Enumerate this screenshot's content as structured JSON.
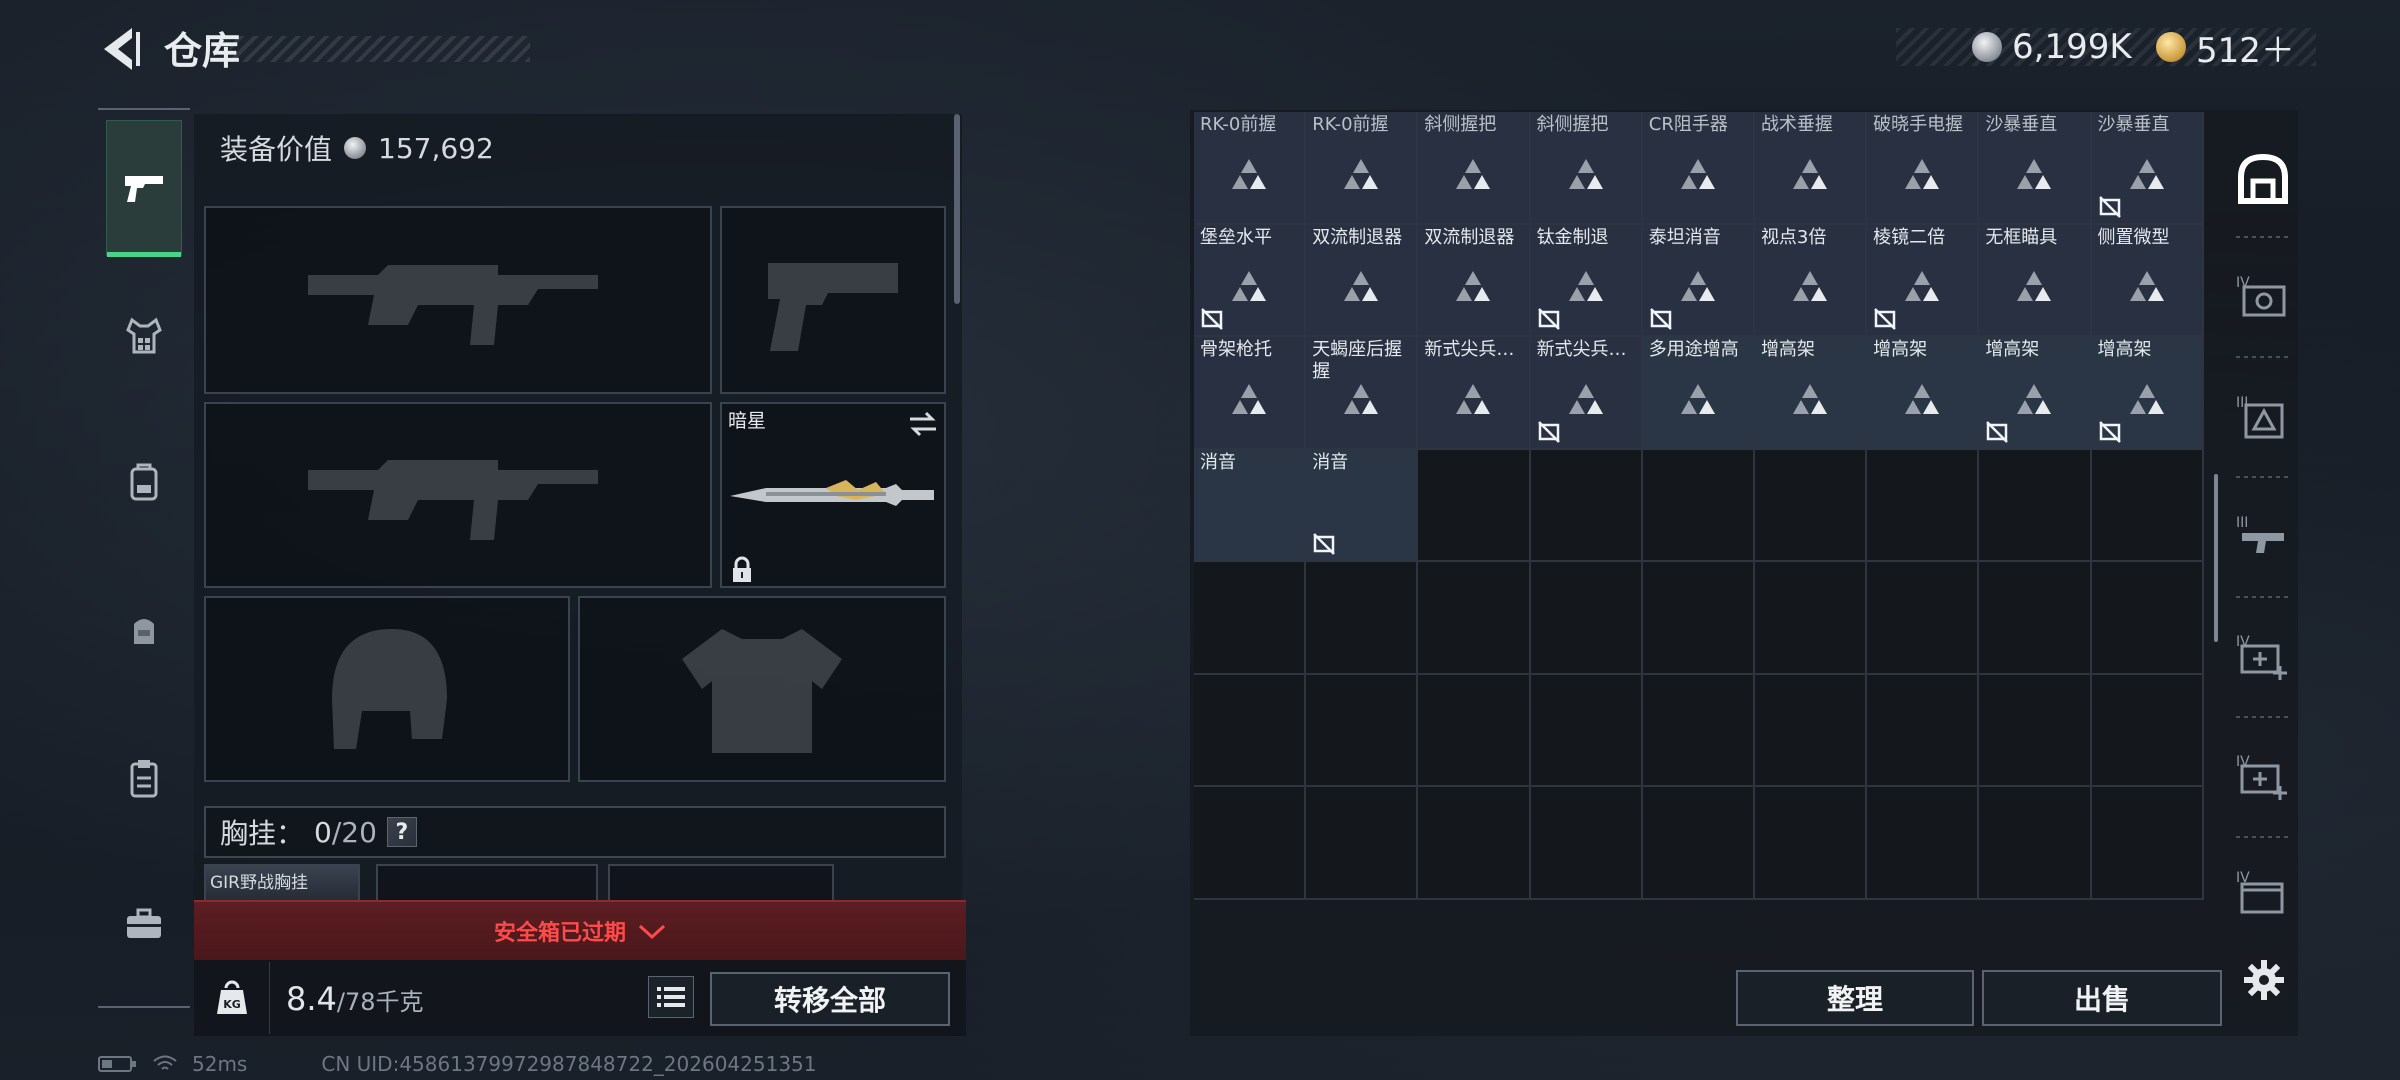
{
  "header": {
    "title": "仓库",
    "currency_silver": "6,199K",
    "currency_gold": "512＋"
  },
  "equipment": {
    "value_label": "装备价值",
    "value": "157,692",
    "melee_name": "暗星",
    "chest_rig_label": "胸挂：",
    "chest_rig_count": "0",
    "chest_rig_capacity": "/20",
    "chest_rig_item": "GIR野战胸挂",
    "help_icon": "?",
    "safebox_expired": "安全箱已过期",
    "weight_current": "8.4",
    "weight_max": "/78千克",
    "transfer_all": "转移全部"
  },
  "warehouse": {
    "items": [
      {
        "name": "RK-0前握",
        "badge": false,
        "dim": true
      },
      {
        "name": "RK-0前握",
        "badge": false,
        "dim": true
      },
      {
        "name": "斜侧握把",
        "badge": false,
        "dim": true
      },
      {
        "name": "斜侧握把",
        "badge": false,
        "dim": true
      },
      {
        "name": "CR阻手器",
        "badge": false,
        "dim": true
      },
      {
        "name": "战术垂握",
        "badge": false,
        "dim": true
      },
      {
        "name": "破晓手电握",
        "badge": false,
        "dim": true
      },
      {
        "name": "沙暴垂直",
        "badge": false,
        "dim": true
      },
      {
        "name": "沙暴垂直",
        "badge": true,
        "dim": true
      },
      {
        "name": "堡垒水平",
        "badge": true
      },
      {
        "name": "双流制退器",
        "badge": false
      },
      {
        "name": "双流制退器",
        "badge": false
      },
      {
        "name": "钛金制退",
        "badge": true
      },
      {
        "name": "泰坦消音",
        "badge": true
      },
      {
        "name": "视点3倍",
        "badge": false
      },
      {
        "name": "棱镜二倍",
        "badge": true
      },
      {
        "name": "无框瞄具",
        "badge": false
      },
      {
        "name": "侧置微型",
        "badge": false
      },
      {
        "name": "骨架枪托",
        "badge": false
      },
      {
        "name": "天蝎座后握握",
        "badge": false
      },
      {
        "name": "新式尖兵…",
        "badge": false
      },
      {
        "name": "新式尖兵…",
        "badge": true
      },
      {
        "name": "多用途增高",
        "badge": false,
        "tint": true
      },
      {
        "name": "增高架",
        "badge": false,
        "tint": true
      },
      {
        "name": "增高架",
        "badge": false,
        "tint": true
      },
      {
        "name": "增高架",
        "badge": true,
        "tint": true
      },
      {
        "name": "增高架",
        "badge": true,
        "tint": true
      },
      {
        "name": "消音",
        "badge": false,
        "tint": true,
        "noicon": true
      },
      {
        "name": "消音",
        "badge": true,
        "tint": true,
        "noicon": true
      }
    ],
    "sort_label": "整理",
    "sell_label": "出售"
  },
  "status": {
    "ping": "52ms",
    "uid": "CN UID:458613799729878487​22_202604251351"
  }
}
